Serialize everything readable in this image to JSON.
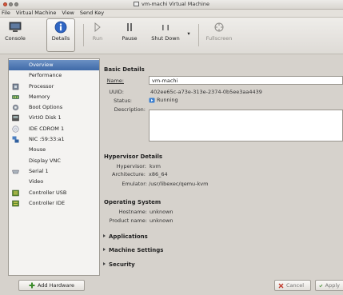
{
  "window": {
    "title": "vm-machi Virtual Machine"
  },
  "menubar": [
    "File",
    "Virtual Machine",
    "View",
    "Send Key"
  ],
  "toolbar": {
    "console": "Console",
    "details": "Details",
    "run": "Run",
    "pause": "Pause",
    "shutdown": "Shut Down",
    "fullscreen": "Fullscreen"
  },
  "sidebar": {
    "items": [
      {
        "label": "Overview",
        "icon": "overview-icon"
      },
      {
        "label": "Performance",
        "icon": "performance-icon"
      },
      {
        "label": "Processor",
        "icon": "processor-icon"
      },
      {
        "label": "Memory",
        "icon": "memory-icon"
      },
      {
        "label": "Boot Options",
        "icon": "boot-icon"
      },
      {
        "label": "VirtIO Disk 1",
        "icon": "disk-icon"
      },
      {
        "label": "IDE CDROM 1",
        "icon": "cdrom-icon"
      },
      {
        "label": "NIC :59:33:a1",
        "icon": "nic-icon"
      },
      {
        "label": "Mouse",
        "icon": "mouse-icon"
      },
      {
        "label": "Display VNC",
        "icon": "display-icon"
      },
      {
        "label": "Serial 1",
        "icon": "serial-icon"
      },
      {
        "label": "Video",
        "icon": "video-icon"
      },
      {
        "label": "Controller USB",
        "icon": "controller-icon"
      },
      {
        "label": "Controller IDE",
        "icon": "controller-icon"
      }
    ],
    "add_hardware": "Add Hardware"
  },
  "basic": {
    "title": "Basic Details",
    "name_label": "Name:",
    "name_value": "vm-machi",
    "uuid_label": "UUID:",
    "uuid_value": "402ee65c-a73e-313e-2374-0b5ee3aa4439",
    "status_label": "Status:",
    "status_value": "Running",
    "description_label": "Description:"
  },
  "hypervisor": {
    "title": "Hypervisor Details",
    "hypervisor_label": "Hypervisor:",
    "hypervisor_value": "kvm",
    "arch_label": "Architecture:",
    "arch_value": "x86_64",
    "emulator_label": "Emulator:",
    "emulator_value": "/usr/libexec/qemu-kvm"
  },
  "os": {
    "title": "Operating System",
    "hostname_label": "Hostname:",
    "hostname_value": "unknown",
    "product_label": "Product name:",
    "product_value": "unknown"
  },
  "expanders": [
    "Applications",
    "Machine Settings",
    "Security"
  ],
  "footer": {
    "cancel": "Cancel",
    "apply": "Apply"
  },
  "colors": {
    "selection": "#4a73ad",
    "running": "#3a7fd0"
  }
}
